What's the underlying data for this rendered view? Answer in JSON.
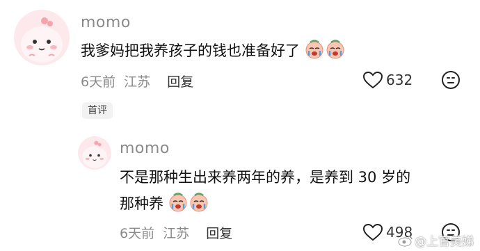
{
  "comments": [
    {
      "username": "momo",
      "text": "我爹妈把我养孩子的钱也准备好了",
      "emoji_icons": [
        "crying-face-emoji-icon",
        "crying-face-emoji-icon"
      ],
      "time": "6天前",
      "location": "江苏",
      "reply_label": "回复",
      "like_count": "632",
      "badge": "首评"
    },
    {
      "username": "momo",
      "text_line1": "不是那种生出来养两年的养，是养到 30 岁的",
      "text_line2": "那种养",
      "emoji_icons": [
        "crying-face-emoji-icon",
        "crying-face-emoji-icon"
      ],
      "time": "6天前",
      "location": "江苏",
      "reply_label": "回复",
      "like_count": "498"
    }
  ],
  "watermark": "@上官美娣",
  "colors": {
    "avatar_bg": "#fbe3e6",
    "avatar_face": "#ffd2d7",
    "muted_text": "#8a8a8a",
    "chip_bg": "#f2f2f2"
  }
}
